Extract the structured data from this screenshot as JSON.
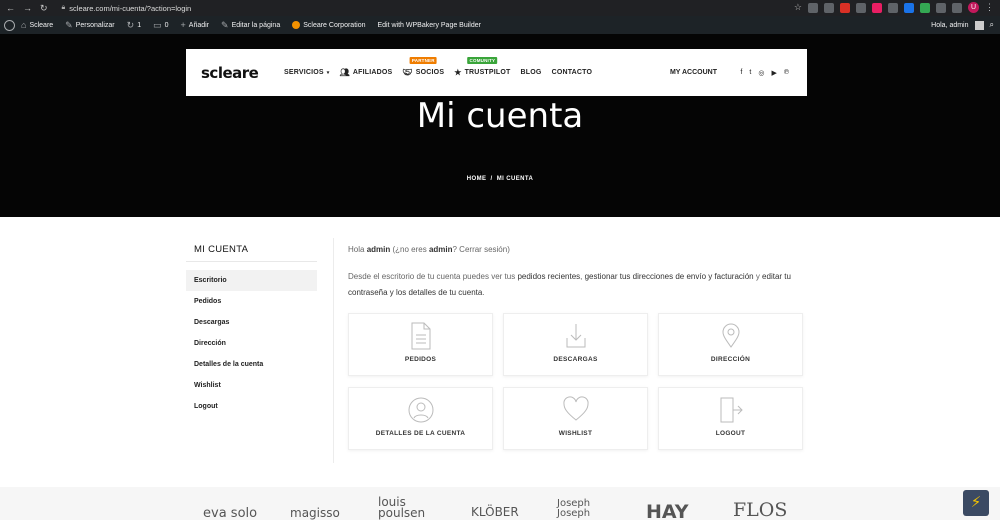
{
  "browser": {
    "url": "scleare.com/mi-cuenta/?action=login",
    "profile_initial": "U"
  },
  "admin_bar": {
    "site": "Scleare",
    "customize": "Personalizar",
    "updates": "1",
    "comments": "0",
    "add_new": "Añadir",
    "edit_page": "Editar la página",
    "corporation": "Scleare Corporation",
    "wpbakery": "Edit with WPBakery Page Builder",
    "greeting": "Hola, admin"
  },
  "header": {
    "logo": "scleare",
    "menu": [
      {
        "label": "SERVICIOS"
      },
      {
        "label": "AFILIADOS"
      },
      {
        "label": "SOCIOS",
        "badge": "PARTNER"
      },
      {
        "label": "TRUSTPILOT",
        "badge": "COMUNITY"
      },
      {
        "label": "BLOG"
      },
      {
        "label": "CONTACTO"
      }
    ],
    "my_account": "MY ACCOUNT",
    "socials": [
      "f",
      "t",
      "◎",
      "▶",
      "℗"
    ]
  },
  "hero": {
    "title": "Mi cuenta",
    "breadcrumb": "HOME  /  MI CUENTA"
  },
  "sidebar": {
    "title": "MI CUENTA",
    "items": [
      "Escritorio",
      "Pedidos",
      "Descargas",
      "Dirección",
      "Detalles de la cuenta",
      "Wishlist",
      "Logout"
    ]
  },
  "main": {
    "greet_prefix": "Hola ",
    "user": "admin",
    "greet_mid": " (¿no eres ",
    "greet_q": "? ",
    "logout_link": "Cerrar sesión",
    "greet_end": ")",
    "intro_1": "Desde el escritorio de tu cuenta puedes ver tus ",
    "intro_2": "pedidos recientes",
    "intro_3": ", ",
    "intro_4": "gestionar tus direcciones de envío y facturación",
    "intro_5": " y ",
    "intro_6": "editar tu contraseña y los detalles de tu cuenta",
    "intro_7": ".",
    "cards": [
      "PEDIDOS",
      "DESCARGAS",
      "DIRECCIÓN",
      "DETALLES DE LA CUENTA",
      "WISHLIST",
      "LOGOUT"
    ]
  },
  "brands": [
    "eva solo",
    "magisso",
    "louis poulsen",
    "KLÖBER",
    "Joseph Joseph",
    "HAY",
    "FLOS"
  ]
}
